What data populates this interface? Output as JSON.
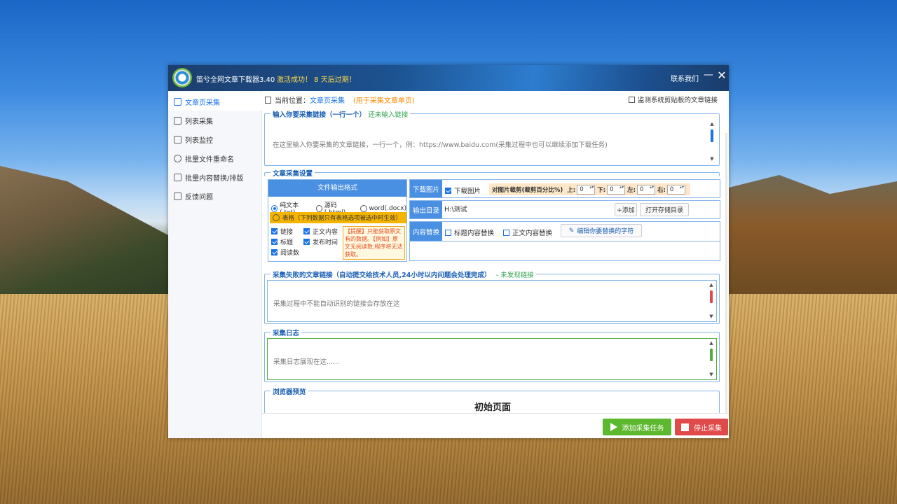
{
  "window": {
    "app_title": "笛兮全网文章下载器3.40",
    "activation": "激活成功！ 8 天后过期！",
    "contact": "联系我们",
    "minimize": "—",
    "close": "✕"
  },
  "sidebar": {
    "items": [
      {
        "label": "文章页采集",
        "icon": "doc-icon",
        "active": true
      },
      {
        "label": "列表采集",
        "icon": "list-icon",
        "active": false
      },
      {
        "label": "列表监控",
        "icon": "monitor-icon",
        "active": false
      },
      {
        "label": "批量文件重命名",
        "icon": "headset-icon",
        "active": false
      },
      {
        "label": "批量内容替换/排版",
        "icon": "replace-icon",
        "active": false
      },
      {
        "label": "反馈问题",
        "icon": "chat-icon",
        "active": false
      }
    ]
  },
  "location": {
    "label": "当前位置：",
    "page": "文章页采集",
    "hint": "(用于采集文章单页)"
  },
  "monitor_clipboard": {
    "label": "监测系统剪贴板的文章链接",
    "checked": false
  },
  "input_section": {
    "title": "输入你要采集链接（一行一个）",
    "status": "还未输入链接",
    "placeholder": "在这里输入你要采集的文章链接，一行一个，例：https://www.baidu.com(采集过程中也可以继续添加下载任务)"
  },
  "settings": {
    "title": "文章采集设置",
    "format_header": "文件输出格式",
    "formats": [
      {
        "label": "纯文本(.txt)",
        "selected": true
      },
      {
        "label": "源码(.html)",
        "selected": false
      },
      {
        "label": "word(.docx)",
        "selected": false
      }
    ],
    "table_option": "表格（下列数据只有表格选项被选中时生效）",
    "fields": [
      {
        "label": "链接",
        "checked": true
      },
      {
        "label": "正文内容",
        "checked": true
      },
      {
        "label": "标题",
        "checked": true
      },
      {
        "label": "发布时间",
        "checked": true
      },
      {
        "label": "阅读数",
        "checked": true
      }
    ],
    "notice": "【提醒】只能获取原文有的数据。【例如】原文无阅读数,程序将无法获取。",
    "download_images": {
      "row_label": "下载图片",
      "checkbox_label": "下载图片",
      "checked": true,
      "crop_label": "对图片裁剪(裁剪百分比%)",
      "top_label": "上:",
      "top": "0",
      "bottom_label": "下:",
      "bottom": "0",
      "left_label": "左:",
      "left": "0",
      "right_label": "右:",
      "right": "0"
    },
    "output_dir": {
      "row_label": "输出目录",
      "value": "H:\\测试",
      "add_button": "+添加",
      "open_button": "打开存储目录"
    },
    "content_replace": {
      "row_label": "内容替换",
      "title_label": "标题内容替换",
      "title_checked": false,
      "body_label": "正文内容替换",
      "body_checked": false,
      "edit_button": "编辑你要替换的字符"
    }
  },
  "failed_section": {
    "title": "采集失败的文章链接（自动提交给技术人员,24小时以内问题会处理完成）",
    "status": "- 未发现链接",
    "placeholder": "采集过程中不能自动识别的链接会存放在这"
  },
  "log_section": {
    "title": "采集日志",
    "placeholder": "采集日志展现在这......"
  },
  "preview_section": {
    "title": "浏览器预览",
    "page_title": "初始页面"
  },
  "actions": {
    "add_task": "添加采集任务",
    "stop": "停止采集"
  },
  "colors": {
    "accent": "#1a73e8",
    "header_blue": "#4a90e2",
    "green_button": "#5cb82e",
    "red_button": "#e14a4a",
    "warning": "#f4b400",
    "activation_text": "#ffd84a"
  }
}
